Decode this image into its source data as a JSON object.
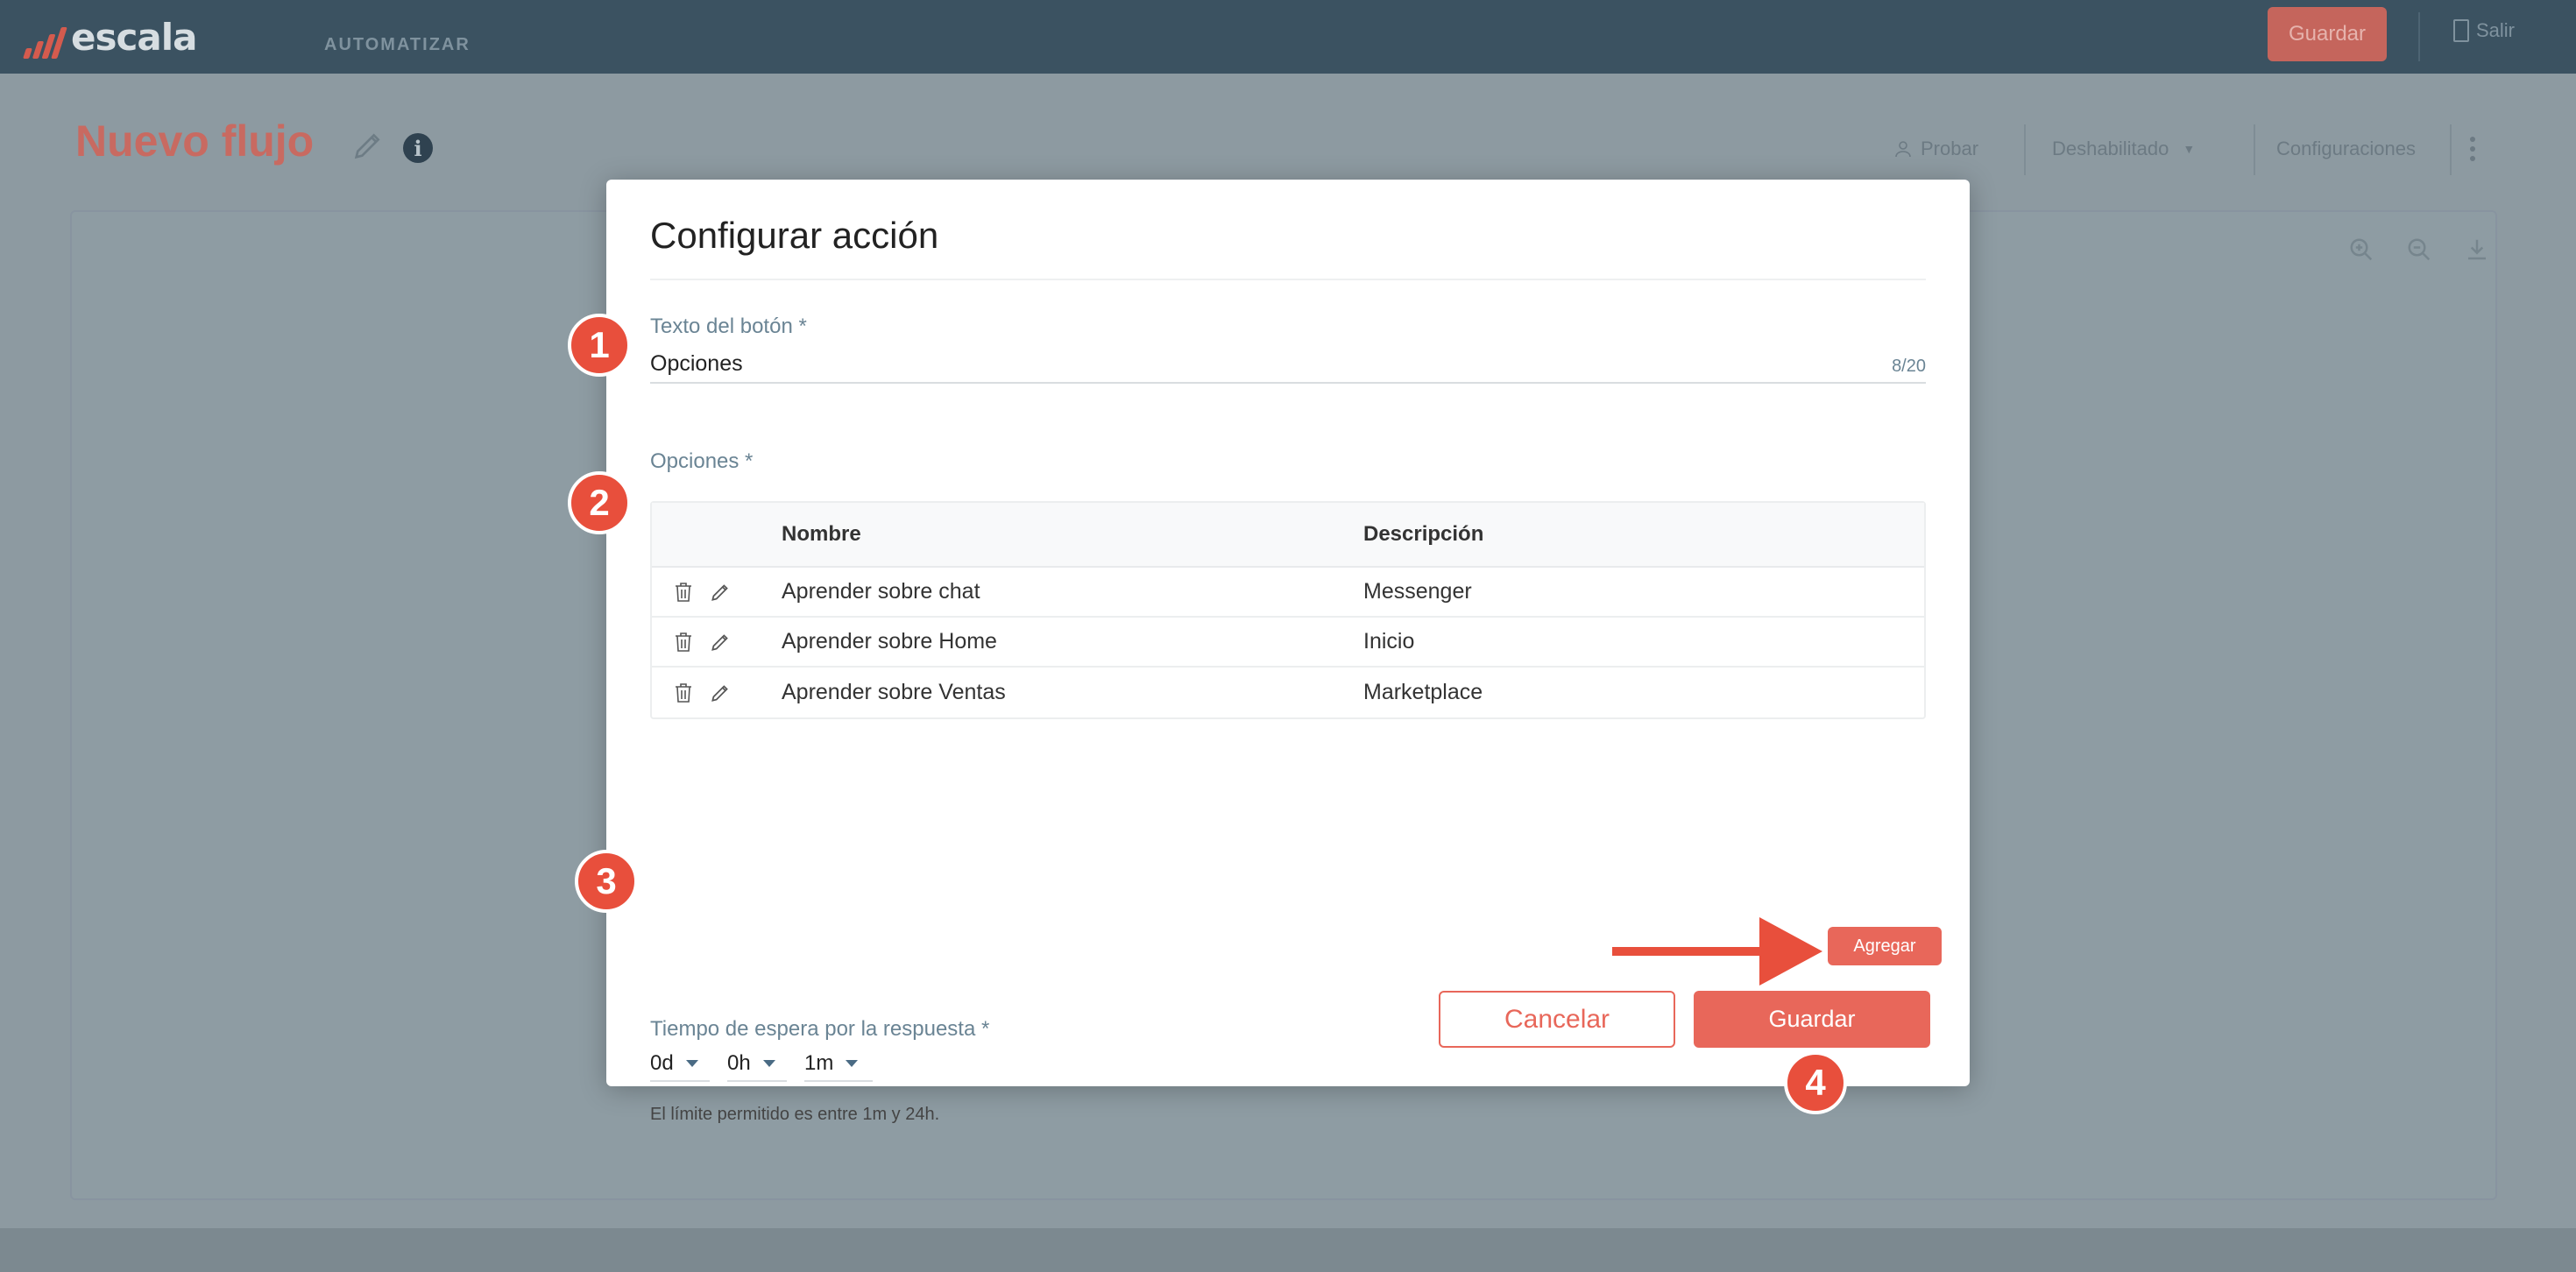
{
  "app": {
    "logo_text": "escala",
    "nav_item": "AUTOMATIZAR",
    "save_label": "Guardar",
    "logout_label": "Salir"
  },
  "page": {
    "title": "Nuevo flujo",
    "toolbar": {
      "test_label": "Probar",
      "status_label": "Deshabilitado",
      "settings_label": "Configuraciones"
    }
  },
  "modal": {
    "title": "Configurar acción",
    "button_text_field": {
      "label": "Texto del botón *",
      "value": "Opciones",
      "counter": "8/20"
    },
    "options": {
      "label": "Opciones *",
      "columns": [
        "Nombre",
        "Descripción"
      ],
      "rows": [
        {
          "name": "Aprender sobre chat",
          "description": "Messenger"
        },
        {
          "name": "Aprender sobre Home",
          "description": "Inicio"
        },
        {
          "name": "Aprender sobre Ventas",
          "description": "Marketplace"
        }
      ],
      "add_label": "Agregar"
    },
    "wait_time": {
      "label": "Tiempo de espera por la respuesta *",
      "days": "0d",
      "hours": "0h",
      "minutes": "1m",
      "hint": "El límite permitido es entre 1m y 24h."
    },
    "cancel_label": "Cancelar",
    "save_label": "Guardar"
  },
  "steps": [
    "1",
    "2",
    "3",
    "4"
  ],
  "colors": {
    "accent": "#e8675a",
    "step_badge": "#e84f3c",
    "label": "#6a8494",
    "topbar": "#3b5261"
  }
}
